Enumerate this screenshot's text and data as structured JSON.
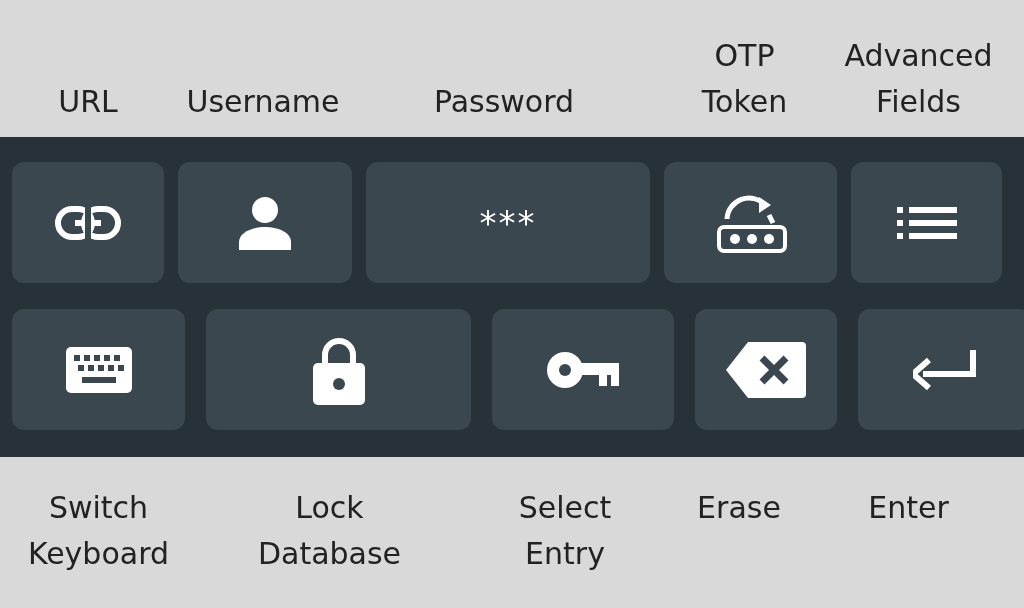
{
  "top_labels": [
    "URL",
    "Username",
    "Password",
    "OTP\nToken",
    "Advanced\nFields"
  ],
  "keyboard": {
    "rows": [
      [
        {
          "kind": "link"
        },
        {
          "kind": "person"
        },
        {
          "kind": "text",
          "text": "***"
        },
        {
          "kind": "otp"
        },
        {
          "kind": "list"
        }
      ],
      [
        {
          "kind": "keyboard"
        },
        {
          "kind": "lock"
        },
        {
          "kind": "key"
        },
        {
          "kind": "erase"
        },
        {
          "kind": "enter"
        }
      ]
    ]
  },
  "bottom_labels": [
    "Switch\nKeyboard",
    "Lock\nDatabase",
    "Select\nEntry",
    "Erase",
    "Enter"
  ]
}
